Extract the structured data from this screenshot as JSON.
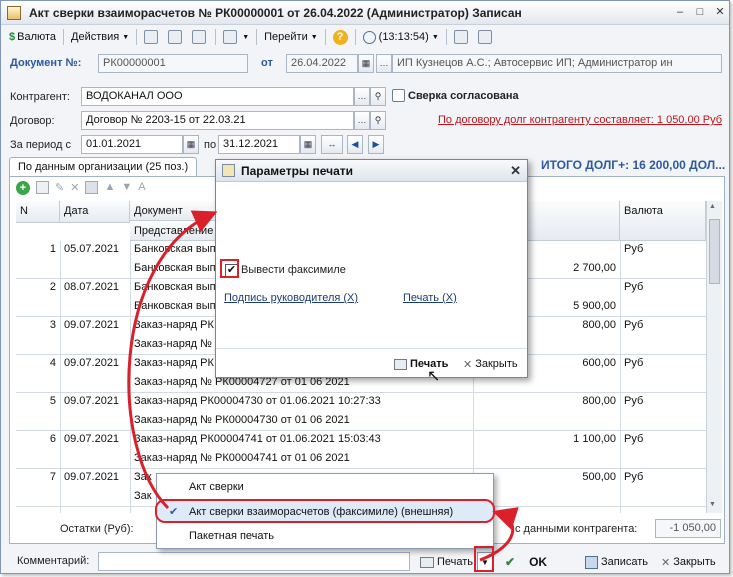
{
  "window": {
    "title": "Акт сверки взаиморасчетов № РК00000001 от 26.04.2022 (Администратор) Записан",
    "minimize": "–",
    "maximize": "□",
    "close": "✕"
  },
  "toolbar": {
    "currency": "Валюта",
    "actions": "Действия",
    "goto": "Перейти",
    "time": "(13:13:54)"
  },
  "header": {
    "doc_no_label": "Документ №:",
    "doc_no": "РК00000001",
    "date_label": "от",
    "date": "26.04.2022",
    "org": "ИП Кузнецов А.С.; Автосервис ИП; Администратор ин",
    "contractor_label": "Контрагент:",
    "contractor": "ВОДОКАНАЛ ООО",
    "agreed_label": "Сверка согласована",
    "contract_label": "Договор:",
    "contract": "Договор № 2203-15  от 22.03.21",
    "debt_link": "По договору долг контрагенту составляет: 1 050,00 Руб",
    "period_label": "За период с",
    "period_from": "01.01.2021",
    "period_to_label": "по",
    "period_to": "31.12.2021"
  },
  "tabs": {
    "org_tab": "По данным организации (25 поз.)",
    "total": "ИТОГО ДОЛГ+: 16 200,00 ДОЛ..."
  },
  "grid": {
    "col_n": "N",
    "col_date": "Дата",
    "col_doc": "Документ",
    "col_repr": "Представление",
    "col_currency": "Валюта",
    "rows": [
      {
        "n": "1",
        "date": "05.07.2021",
        "doc1": "Банковская вып",
        "doc2": "Банковская вып",
        "sum1": "",
        "sum2": "2 700,00",
        "cur": "Руб"
      },
      {
        "n": "2",
        "date": "08.07.2021",
        "doc1": "Банковская вып",
        "doc2": "Банковская вып",
        "sum1": "",
        "sum2": "5 900,00",
        "cur": "Руб"
      },
      {
        "n": "3",
        "date": "09.07.2021",
        "doc1": "Заказ-наряд РК",
        "doc2": "Заказ-наряд № ",
        "sum1": "800,00",
        "sum2": "",
        "cur": "Руб"
      },
      {
        "n": "4",
        "date": "09.07.2021",
        "doc1": "Заказ-наряд РК",
        "doc2": "Заказ-наряд № РК00004727 от 01 06 2021",
        "sum1": "600,00",
        "sum2": "",
        "cur": "Руб"
      },
      {
        "n": "5",
        "date": "09.07.2021",
        "doc1": "Заказ-наряд РК00004730 от 01.06.2021 10:27:33",
        "doc2": "Заказ-наряд № РК00004730 от 01 06 2021",
        "sum1": "800,00",
        "sum2": "",
        "cur": "Руб"
      },
      {
        "n": "6",
        "date": "09.07.2021",
        "doc1": "Заказ-наряд РК00004741 от 01.06.2021 15:03:43",
        "doc2": "Заказ-наряд № РК00004741 от 01 06 2021",
        "sum1": "1 100,00",
        "sum2": "",
        "cur": "Руб"
      },
      {
        "n": "7",
        "date": "09.07.2021",
        "doc1": "Зак",
        "doc2": "Зак",
        "sum1": "500,00",
        "sum2": "",
        "cur": "Руб"
      }
    ],
    "remains_label": "Остатки (Руб):",
    "reconcile_label": "с данными контрагента:",
    "reconcile_value": "-1 050,00"
  },
  "dialog": {
    "title": "Параметры печати",
    "facsimile_label": "Вывести факсимиле",
    "signature_link": "Подпись руководителя (X)",
    "stamp_link": "Печать (X)",
    "print_button": "Печать",
    "close_button": "Закрыть"
  },
  "popup": {
    "items": [
      "Акт сверки",
      "Акт сверки взаиморасчетов (факсимиле) (внешняя)",
      "Пакетная печать"
    ]
  },
  "bottom": {
    "comment_label": "Комментарий:",
    "print": "Печать",
    "ok": "OK",
    "save": "Записать",
    "close": "Закрыть"
  }
}
